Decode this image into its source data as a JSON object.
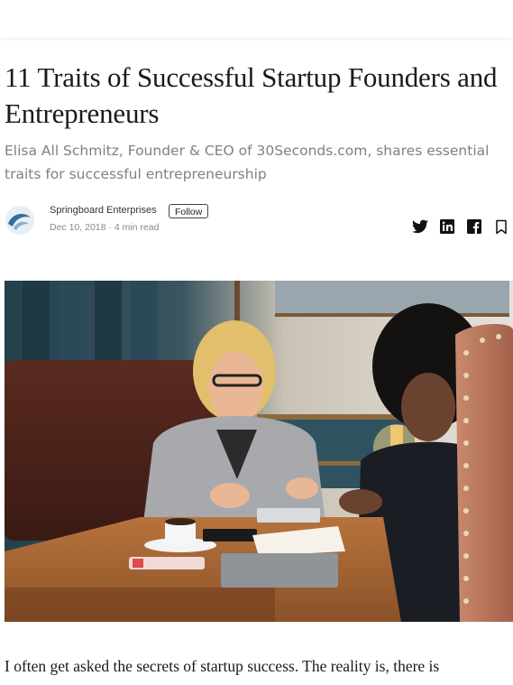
{
  "article": {
    "title": "11 Traits of Successful Startup Founders and Entrepreneurs",
    "subtitle": "Elisa All Schmitz, Founder & CEO of 30Seconds.com, shares essential traits for successful entrepreneurship",
    "author": {
      "name": "Springboard Enterprises",
      "follow_label": "Follow",
      "date": "Dec 10, 2018",
      "read_time": "4 min read",
      "separator": " · "
    },
    "share_icons": [
      "twitter-icon",
      "linkedin-icon",
      "facebook-icon",
      "bookmark-icon"
    ],
    "image": {
      "subject": "two-women-meeting-at-cafe-table"
    },
    "body_first_line": "I often get asked the secrets of startup success. The reality is, there is"
  },
  "colors": {
    "title": "#1a1a1a",
    "subtitle": "#808080",
    "meta": "#888888",
    "avatar_blue": "#2f6f9e"
  }
}
